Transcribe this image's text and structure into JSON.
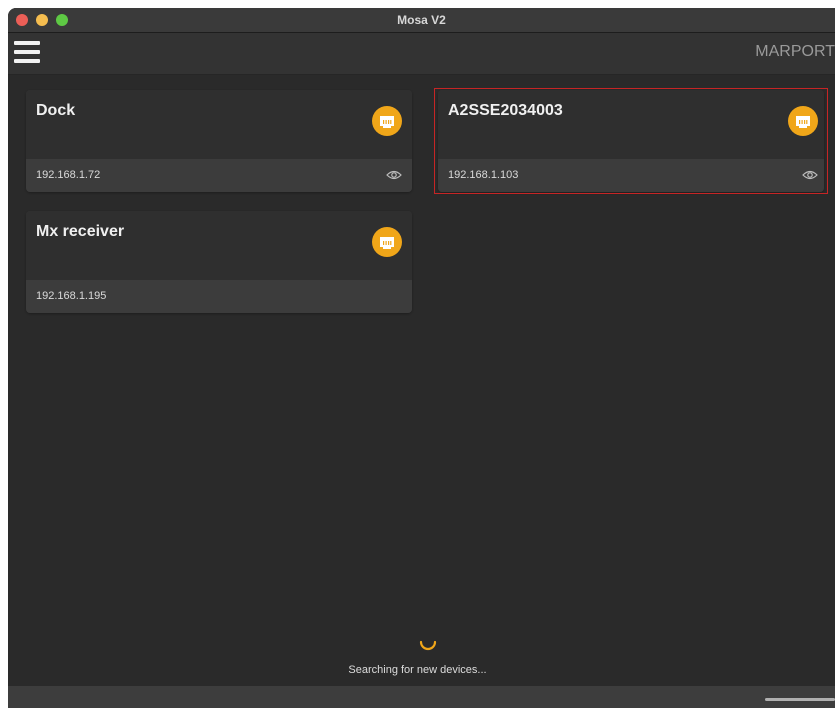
{
  "window": {
    "title": "Mosa V2",
    "traffic_lights": [
      "#ec5f57",
      "#f5bd4f",
      "#5ec944"
    ]
  },
  "header": {
    "menu_icon": "hamburger-menu-icon",
    "logo_text": "MARPORT"
  },
  "devices": [
    {
      "name": "Dock",
      "ip": "192.168.1.72",
      "connection_icon": "ethernet-icon",
      "show_eye": true,
      "selected": false
    },
    {
      "name": "A2SSE2034003",
      "ip": "192.168.1.103",
      "connection_icon": "ethernet-icon",
      "show_eye": true,
      "selected": true
    },
    {
      "name": "Mx receiver",
      "ip": "192.168.1.195",
      "connection_icon": "ethernet-icon",
      "show_eye": false,
      "selected": false
    }
  ],
  "status": {
    "text": "Searching for new devices...",
    "spinner_icon": "loading-spinner-icon"
  },
  "colors": {
    "accent": "#f0a619",
    "selected_border": "#c62525",
    "background": "#2a2a2a",
    "card": "#2f2f2f"
  }
}
